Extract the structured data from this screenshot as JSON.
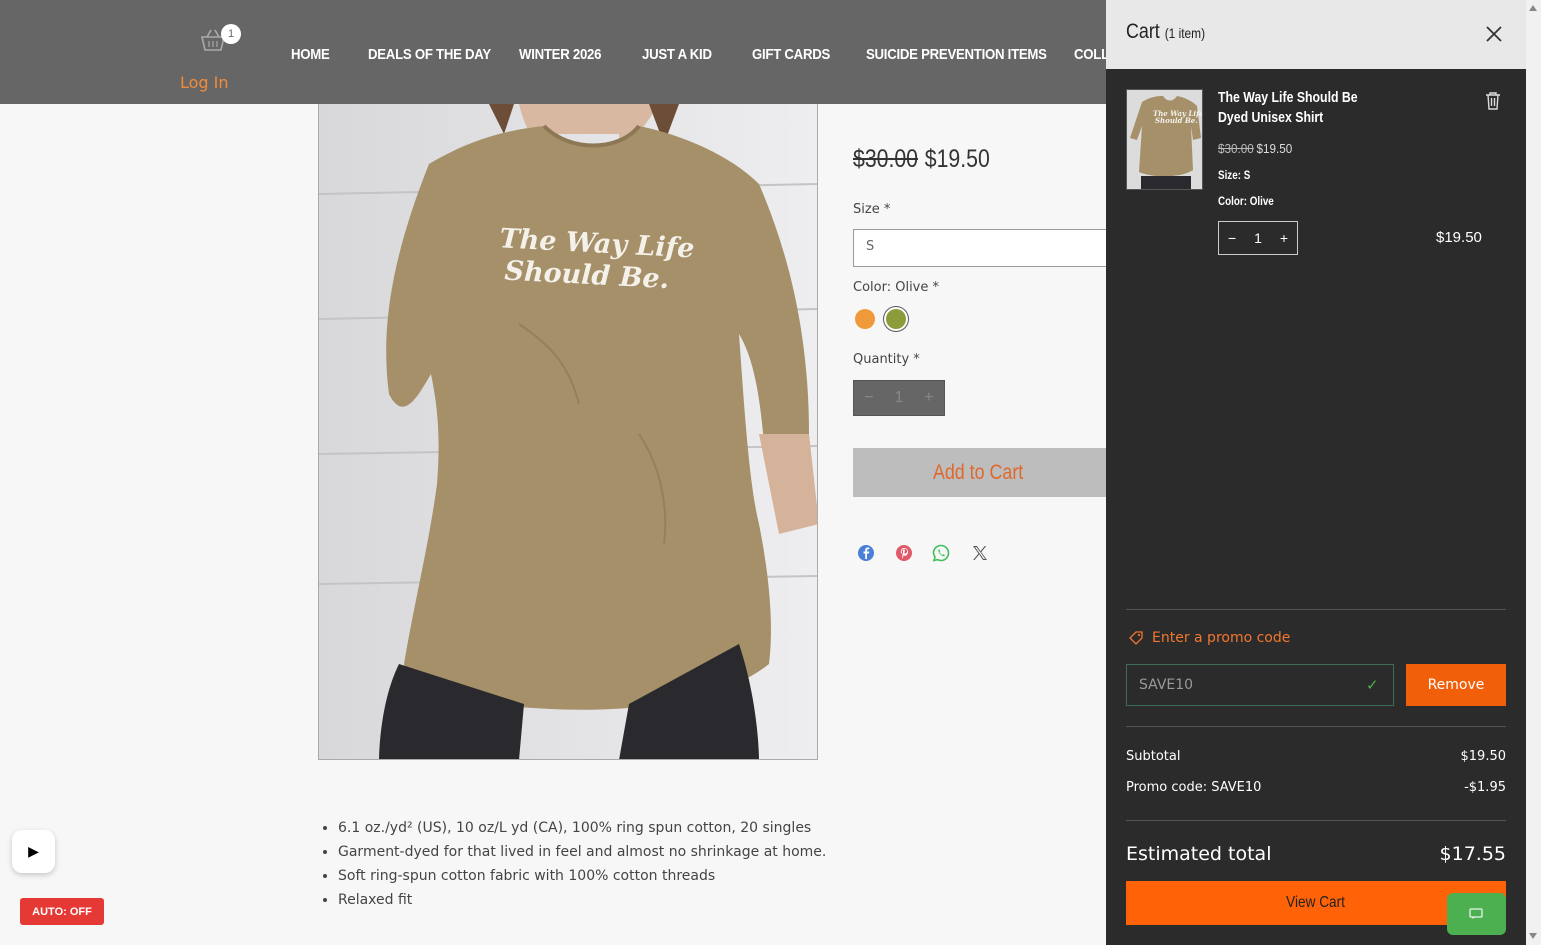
{
  "header": {
    "cart_count": "1",
    "login_label": "Log In",
    "nav": [
      "HOME",
      "DEALS OF THE DAY",
      "WINTER 2026",
      "JUST A KID",
      "GIFT CARDS",
      "SUICIDE PREVENTION ITEMS",
      "COLL"
    ]
  },
  "product": {
    "shirt_text_line1": "The Way Life",
    "shirt_text_line2": "Should Be.",
    "old_price": "$30.00",
    "price": "$19.50",
    "size_label": "Size *",
    "size_value": "S",
    "color_label": "Color: Olive *",
    "swatch_colors": [
      "#ef9a3a",
      "#8e9b3a"
    ],
    "quantity_label": "Quantity *",
    "quantity_value": "1",
    "add_to_cart": "Add to Cart",
    "share_icons": [
      "facebook-icon",
      "pinterest-icon",
      "whatsapp-icon",
      "x-icon"
    ],
    "description": [
      "6.1 oz./yd² (US), 10 oz/L yd (CA), 100% ring spun cotton, 20 singles",
      "Garment-dyed for that lived in feel and almost no shrinkage at home.",
      "Soft ring-spun cotton fabric with 100% cotton threads",
      "Relaxed fit"
    ]
  },
  "widgets": {
    "auto_label": "AUTO: OFF"
  },
  "cart": {
    "title": "Cart",
    "item_count": "(1 item)",
    "item": {
      "name": "The Way Life Should Be Dyed Unisex Shirt",
      "old_price": "$30.00",
      "price": "$19.50",
      "size": "Size: S",
      "color": "Color: Olive",
      "quantity": "1",
      "line_total": "$19.50"
    },
    "promo_link": "Enter a promo code",
    "promo_value": "SAVE10",
    "remove_label": "Remove",
    "subtotal_label": "Subtotal",
    "subtotal_value": "$19.50",
    "promo_row_label": "Promo code: SAVE10",
    "promo_row_value": "-$1.95",
    "estimated_label": "Estimated total",
    "estimated_value": "$17.55",
    "view_cart": "View Cart"
  },
  "colors": {
    "header_bg": "#666666",
    "accent_orange": "#ff6207",
    "drawer_bg": "#2b2b2b"
  }
}
